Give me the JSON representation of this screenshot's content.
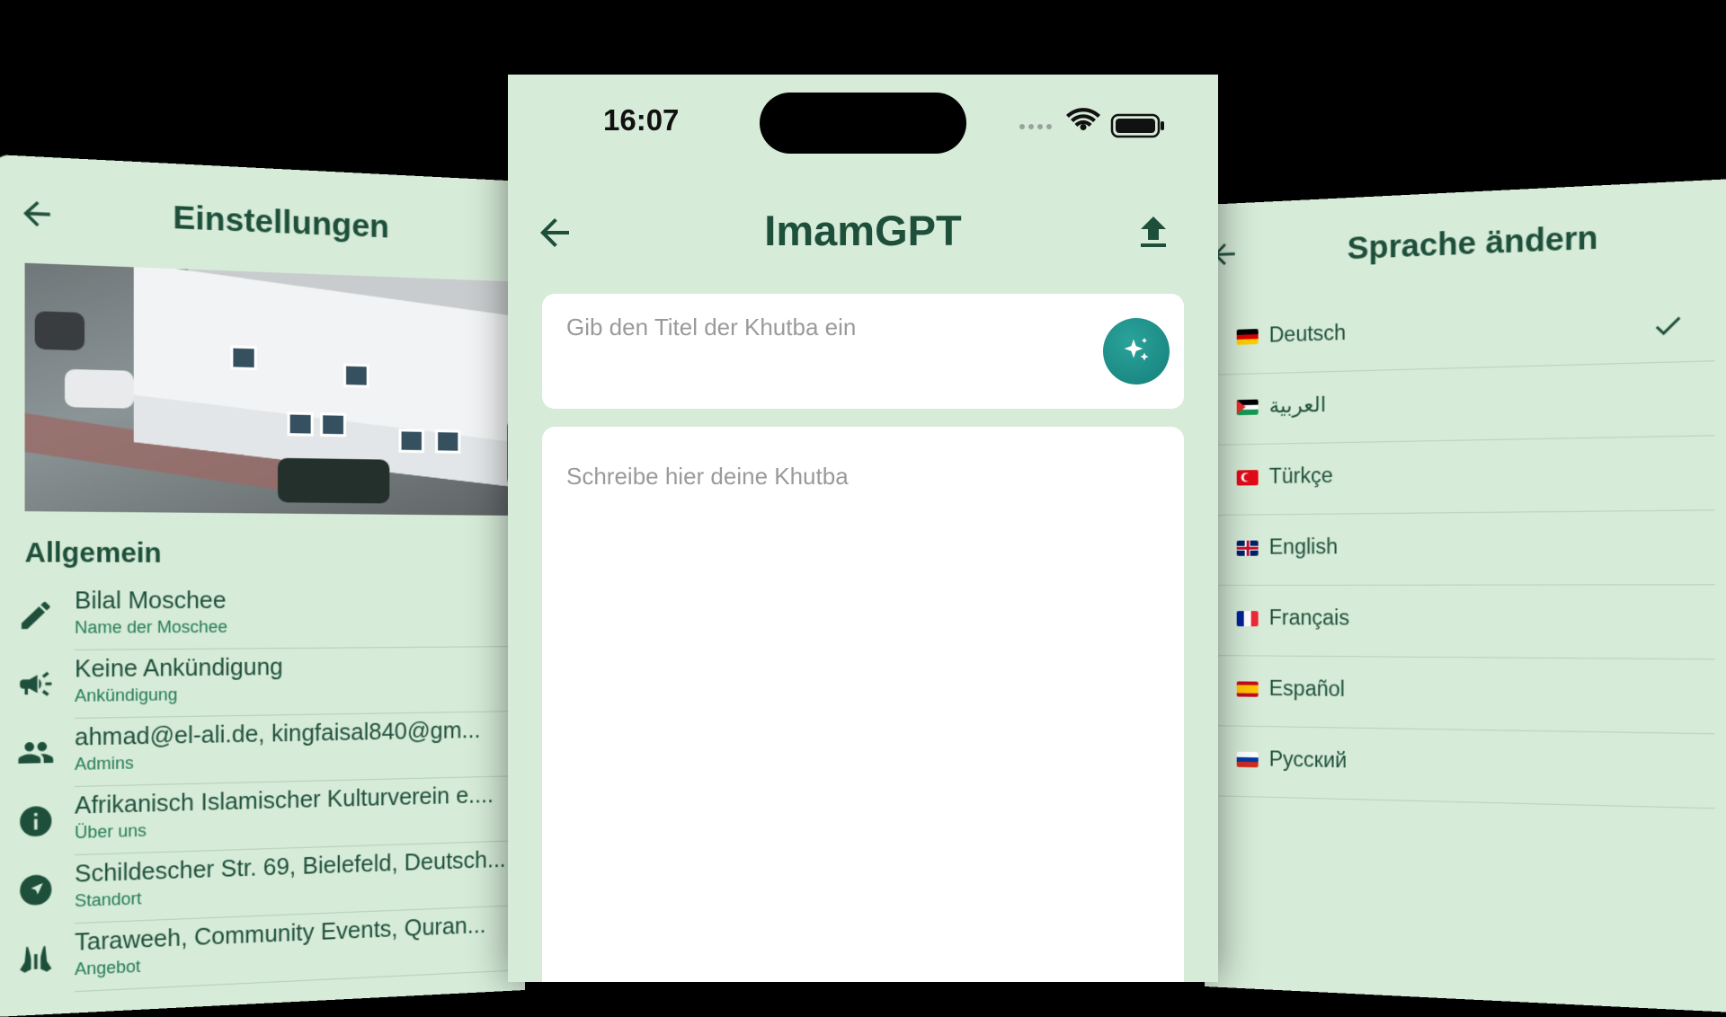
{
  "settings_screen": {
    "title": "Einstellungen",
    "section_title": "Allgemein",
    "items": [
      {
        "icon": "pencil-icon",
        "primary": "Bilal Moschee",
        "secondary": "Name der Moschee"
      },
      {
        "icon": "megaphone-icon",
        "primary": "Keine Ankündigung",
        "secondary": "Ankündigung"
      },
      {
        "icon": "people-icon",
        "primary": "ahmad@el-ali.de, kingfaisal840@gm...",
        "secondary": "Admins"
      },
      {
        "icon": "info-icon",
        "primary": "Afrikanisch Islamischer Kulturverein e....",
        "secondary": "Über uns"
      },
      {
        "icon": "navigation-icon",
        "primary": "Schildescher Str. 69, Bielefeld, Deutsch...",
        "secondary": "Standort"
      },
      {
        "icon": "praying-hands-icon",
        "primary": "Taraweeh, Community Events, Quran...",
        "secondary": "Angebot"
      }
    ]
  },
  "khutba_screen": {
    "status_time": "16:07",
    "title": "ImamGPT",
    "title_input_placeholder": "Gib den Titel der Khutba ein",
    "body_input_placeholder": "Schreibe hier deine Khutba"
  },
  "language_screen": {
    "title": "Sprache ändern",
    "languages": [
      {
        "flag": "de",
        "label": "Deutsch",
        "selected": true
      },
      {
        "flag": "ps",
        "label": "العربية",
        "selected": false
      },
      {
        "flag": "tr",
        "label": "Türkçe",
        "selected": false
      },
      {
        "flag": "gb",
        "label": "English",
        "selected": false
      },
      {
        "flag": "fr",
        "label": "Français",
        "selected": false
      },
      {
        "flag": "es",
        "label": "Español",
        "selected": false
      },
      {
        "flag": "ru",
        "label": "Русский",
        "selected": false
      }
    ]
  },
  "colors": {
    "panel_bg": "#d6ebd8",
    "heading": "#1d4f3a",
    "accent": "#237a55",
    "ai_button": "#1e918a"
  }
}
